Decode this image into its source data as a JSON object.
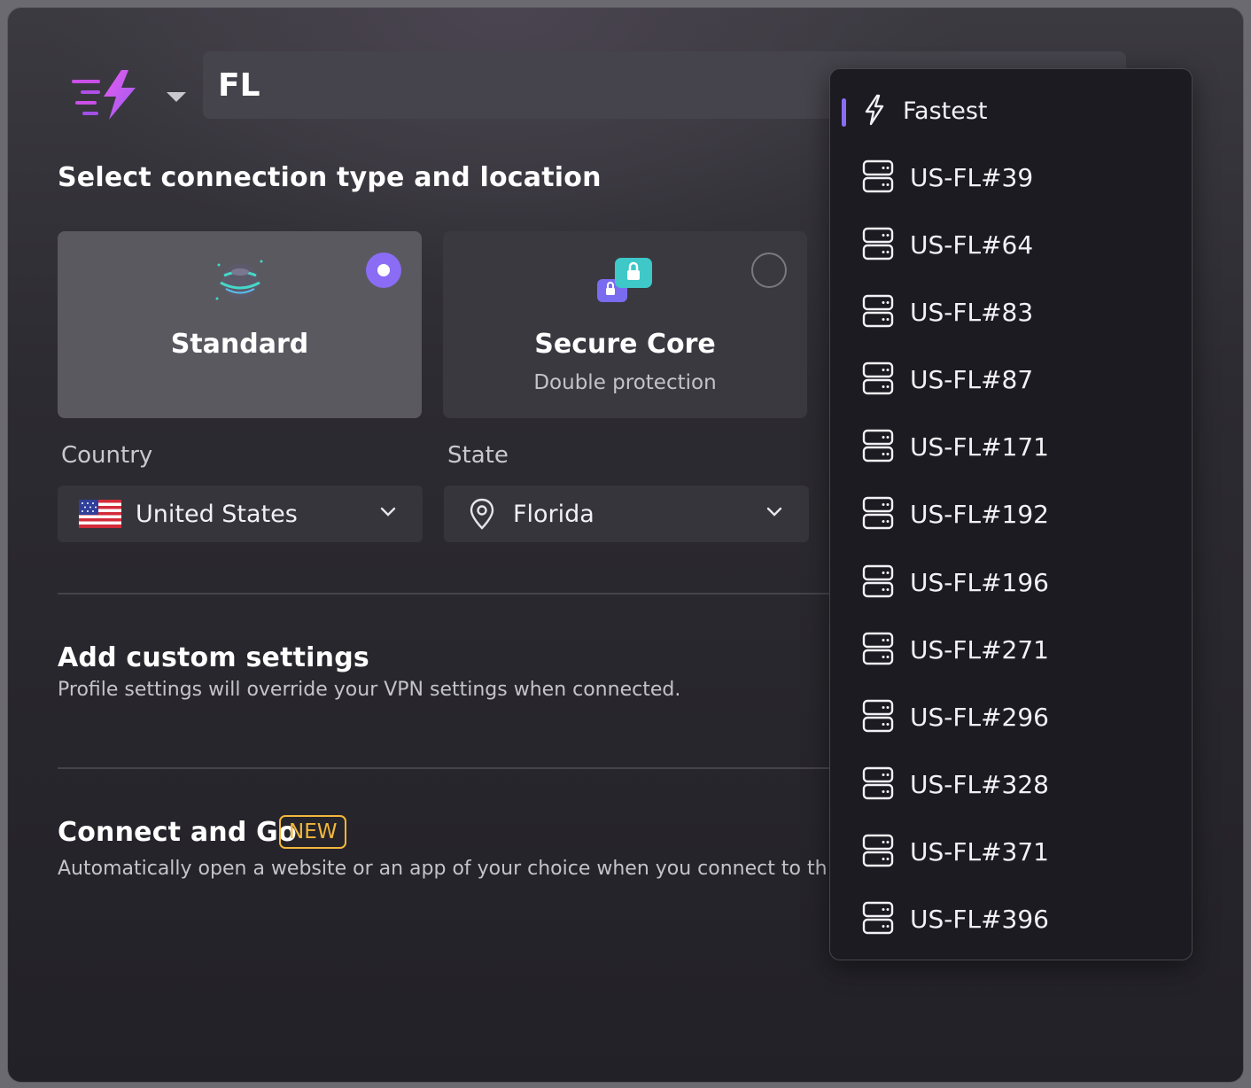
{
  "header": {
    "profile_name": "FL"
  },
  "connection": {
    "heading": "Select connection type and location",
    "standard": {
      "title": "Standard",
      "selected": true
    },
    "secure_core": {
      "title": "Secure Core",
      "subtitle": "Double protection",
      "selected": false
    }
  },
  "country": {
    "label": "Country",
    "value": "United States",
    "flag_icon": "us-flag-icon"
  },
  "state": {
    "label": "State",
    "value": "Florida"
  },
  "custom_settings": {
    "title": "Add custom settings",
    "description": "Profile settings will override your VPN settings when connected."
  },
  "connect_and_go": {
    "title": "Connect and Go",
    "badge": "NEW",
    "description": "Automatically open a website or an app of your choice when you connect to this"
  },
  "server_dropdown": {
    "selected_index": 0,
    "items": [
      {
        "label": "Fastest",
        "icon": "lightning-icon"
      },
      {
        "label": "US-FL#39",
        "icon": "server-icon"
      },
      {
        "label": "US-FL#64",
        "icon": "server-icon"
      },
      {
        "label": "US-FL#83",
        "icon": "server-icon"
      },
      {
        "label": "US-FL#87",
        "icon": "server-icon"
      },
      {
        "label": "US-FL#171",
        "icon": "server-icon"
      },
      {
        "label": "US-FL#192",
        "icon": "server-icon"
      },
      {
        "label": "US-FL#196",
        "icon": "server-icon"
      },
      {
        "label": "US-FL#271",
        "icon": "server-icon"
      },
      {
        "label": "US-FL#296",
        "icon": "server-icon"
      },
      {
        "label": "US-FL#328",
        "icon": "server-icon"
      },
      {
        "label": "US-FL#371",
        "icon": "server-icon"
      },
      {
        "label": "US-FL#396",
        "icon": "server-icon"
      }
    ]
  },
  "colors": {
    "accent": "#8b6cf5",
    "badge": "#f3b73b",
    "dropdown_bg": "#1c1b21"
  }
}
